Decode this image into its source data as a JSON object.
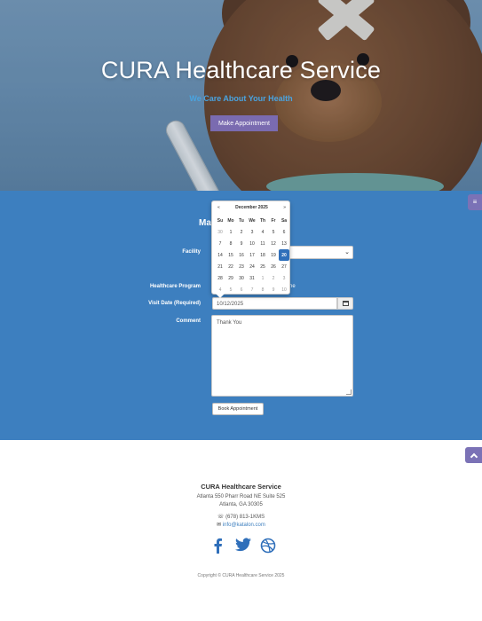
{
  "hero": {
    "title": "CURA Healthcare Service",
    "subtitle": "We Care About Your Health",
    "button_label": "Make Appointment"
  },
  "appointment": {
    "heading": "Ma",
    "labels": {
      "facility": "Facility",
      "program": "Healthcare Program",
      "visit_date": "Visit Date (Required)",
      "comment": "Comment"
    },
    "program_tail": "ne",
    "visit_date_value": "10/12/2025",
    "comment_value": "Thank You",
    "book_button": "Book Appointment"
  },
  "datepicker": {
    "prev": "«",
    "next": "»",
    "title": "December 2025",
    "weekdays": [
      "Su",
      "Mo",
      "Tu",
      "We",
      "Th",
      "Fr",
      "Sa"
    ],
    "weeks": [
      [
        "30",
        "1",
        "2",
        "3",
        "4",
        "5",
        "6"
      ],
      [
        "7",
        "8",
        "9",
        "10",
        "11",
        "12",
        "13"
      ],
      [
        "14",
        "15",
        "16",
        "17",
        "18",
        "19",
        "20"
      ],
      [
        "21",
        "22",
        "23",
        "24",
        "25",
        "26",
        "27"
      ],
      [
        "28",
        "29",
        "30",
        "31",
        "1",
        "2",
        "3"
      ],
      [
        "4",
        "5",
        "6",
        "7",
        "8",
        "9",
        "10"
      ]
    ],
    "selected_day": "20"
  },
  "side_menu": {
    "icon": "menu-icon"
  },
  "to_top": {
    "icon": "chevron-up-icon"
  },
  "footer": {
    "name": "CURA Healthcare Service",
    "address_line1": "Atlanta 550 Pharr Road NE Suite 525",
    "address_line2": "Atlanta, GA 30305",
    "phone": "(678) 813-1KMS",
    "email": "info@katalon.com",
    "copyright": "Copyright © CURA Healthcare Service 2025"
  },
  "colors": {
    "section_blue": "#3d7fbf",
    "accent_purple": "#7b72b6",
    "subtitle_blue": "#4aa3df",
    "selected_blue": "#2f6fba"
  }
}
